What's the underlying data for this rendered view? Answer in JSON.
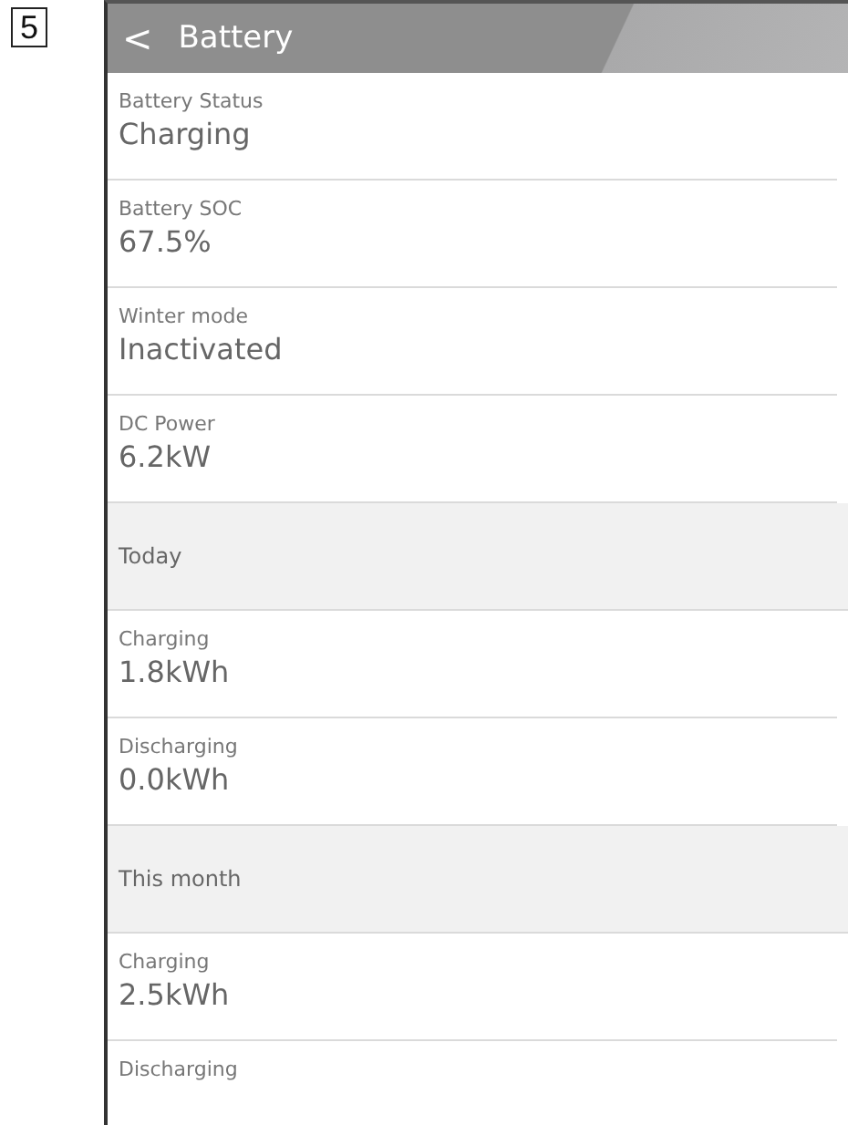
{
  "figure_label": "5",
  "header": {
    "back": "<",
    "title": "Battery"
  },
  "rows": [
    {
      "kind": "item",
      "label": "Battery Status",
      "value": "Charging"
    },
    {
      "kind": "item",
      "label": "Battery SOC",
      "value": "67.5%"
    },
    {
      "kind": "item",
      "label": "Winter mode",
      "value": "Inactivated"
    },
    {
      "kind": "item",
      "label": "DC Power",
      "value": "6.2kW"
    },
    {
      "kind": "section",
      "label": "Today"
    },
    {
      "kind": "item",
      "label": "Charging",
      "value": "1.8kWh"
    },
    {
      "kind": "item",
      "label": "Discharging",
      "value": "0.0kWh"
    },
    {
      "kind": "section",
      "label": "This month"
    },
    {
      "kind": "item",
      "label": "Charging",
      "value": "2.5kWh"
    },
    {
      "kind": "item",
      "label": "Discharging"
    }
  ]
}
